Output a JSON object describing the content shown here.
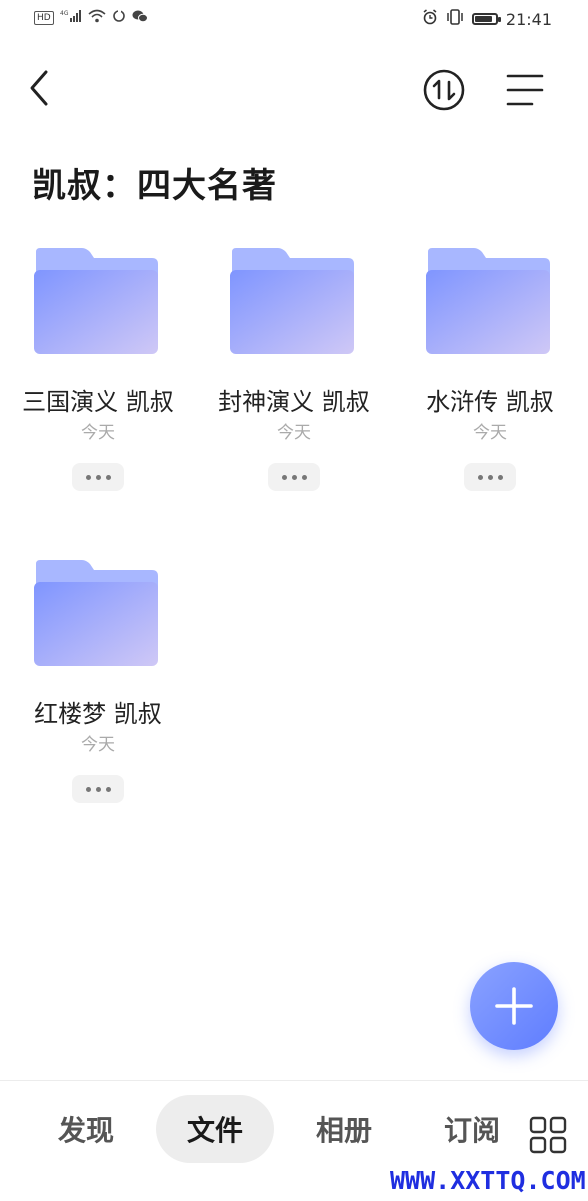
{
  "status_bar": {
    "left_glyphs": [
      "HD",
      "4G",
      "signal",
      "wifi",
      "sync",
      "wechat"
    ],
    "time": "21:41",
    "battery_level": 0.85
  },
  "header": {
    "back_icon": "chevron-left-icon",
    "sort_icon": "swap-vertical-circle-icon",
    "menu_icon": "list-menu-icon"
  },
  "page": {
    "title": "凯叔：四大名著"
  },
  "folders": [
    {
      "name": "三国演义 凯叔",
      "date": "今天"
    },
    {
      "name": "封神演义 凯叔",
      "date": "今天"
    },
    {
      "name": "水浒传 凯叔",
      "date": "今天"
    },
    {
      "name": "红楼梦 凯叔",
      "date": "今天"
    }
  ],
  "fab": {
    "icon": "plus-icon"
  },
  "bottom_nav": {
    "tabs": [
      {
        "label": "发现",
        "active": false
      },
      {
        "label": "文件",
        "active": true
      },
      {
        "label": "相册",
        "active": false
      },
      {
        "label": "订阅",
        "active": false
      }
    ],
    "grid_icon": "grid-icon"
  },
  "watermark": "WWW.XXTTQ.COM",
  "colors": {
    "folder_front": "#8a9cff",
    "folder_back": "#a9b8ff",
    "accent": "#6a86ff"
  }
}
